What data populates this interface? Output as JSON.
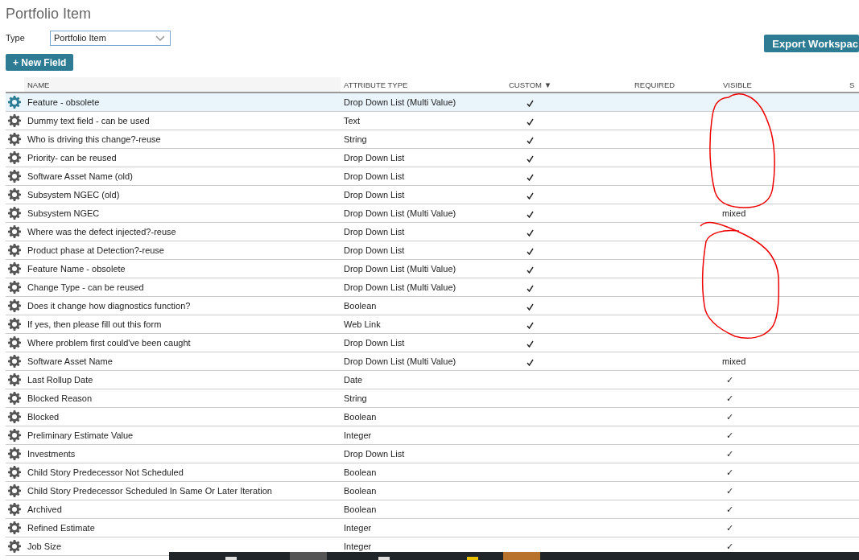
{
  "page": {
    "title": "Portfolio Item"
  },
  "type_field": {
    "label": "Type",
    "value": "Portfolio Item"
  },
  "buttons": {
    "new_field": "+ New Field",
    "export": "Export Workspac"
  },
  "table": {
    "columns": [
      {
        "label": "NAME",
        "kind": "text"
      },
      {
        "label": "ATTRIBUTE TYPE",
        "kind": "text"
      },
      {
        "label": "CUSTOM",
        "kind": "check",
        "sorted": true,
        "sort_icon": "▼"
      },
      {
        "label": "REQUIRED",
        "kind": "text"
      },
      {
        "label": "VISIBLE",
        "kind": "text"
      },
      {
        "label": "S",
        "kind": "text"
      }
    ],
    "rows": [
      {
        "name": "Feature - obsolete",
        "type": "Drop Down List (Multi Value)",
        "custom": true,
        "visible": "",
        "selected": true
      },
      {
        "name": "Dummy text field - can be used",
        "type": "Text",
        "custom": true,
        "visible": "",
        "selected": false
      },
      {
        "name": "Who is driving this change?-reuse",
        "type": "String",
        "custom": true,
        "visible": "",
        "selected": false
      },
      {
        "name": "Priority- can be reused",
        "type": "Drop Down List",
        "custom": true,
        "visible": "",
        "selected": false
      },
      {
        "name": "Software Asset Name (old)",
        "type": "Drop Down List",
        "custom": true,
        "visible": "",
        "selected": false
      },
      {
        "name": "Subsystem NGEC (old)",
        "type": "Drop Down List",
        "custom": true,
        "visible": "",
        "selected": false
      },
      {
        "name": "Subsystem NGEC",
        "type": "Drop Down List (Multi Value)",
        "custom": true,
        "visible": "mixed",
        "selected": false
      },
      {
        "name": "Where was the defect injected?-reuse",
        "type": "Drop Down List",
        "custom": true,
        "visible": "",
        "selected": false
      },
      {
        "name": "Product phase at Detection?-reuse",
        "type": "Drop Down List",
        "custom": true,
        "visible": "",
        "selected": false
      },
      {
        "name": "Feature Name - obsolete",
        "type": "Drop Down List (Multi Value)",
        "custom": true,
        "visible": "",
        "selected": false
      },
      {
        "name": "Change Type - can be reused",
        "type": "Drop Down List (Multi Value)",
        "custom": true,
        "visible": "",
        "selected": false
      },
      {
        "name": "Does it change how diagnostics function?",
        "type": "Boolean",
        "custom": true,
        "visible": "",
        "selected": false
      },
      {
        "name": "If yes, then please fill out this form",
        "type": "Web Link",
        "custom": true,
        "visible": "",
        "selected": false
      },
      {
        "name": "Where problem first could've been caught",
        "type": "Drop Down List",
        "custom": true,
        "visible": "",
        "selected": false
      },
      {
        "name": "Software Asset Name",
        "type": "Drop Down List (Multi Value)",
        "custom": true,
        "visible": "mixed",
        "selected": false
      },
      {
        "name": "Last Rollup Date",
        "type": "Date",
        "custom": false,
        "visible": "✓",
        "selected": false
      },
      {
        "name": "Blocked Reason",
        "type": "String",
        "custom": false,
        "visible": "✓",
        "selected": false
      },
      {
        "name": "Blocked",
        "type": "Boolean",
        "custom": false,
        "visible": "✓",
        "selected": false
      },
      {
        "name": "Preliminary Estimate Value",
        "type": "Integer",
        "custom": false,
        "visible": "✓",
        "selected": false
      },
      {
        "name": "Investments",
        "type": "Drop Down List",
        "custom": false,
        "visible": "✓",
        "selected": false
      },
      {
        "name": "Child Story Predecessor Not Scheduled",
        "type": "Boolean",
        "custom": false,
        "visible": "✓",
        "selected": false
      },
      {
        "name": "Child Story Predecessor Scheduled In Same Or Later Iteration",
        "type": "Boolean",
        "custom": false,
        "visible": "✓",
        "selected": false
      },
      {
        "name": "Archived",
        "type": "Boolean",
        "custom": false,
        "visible": "✓",
        "selected": false
      },
      {
        "name": "Refined Estimate",
        "type": "Integer",
        "custom": false,
        "visible": "✓",
        "selected": false
      },
      {
        "name": "Job Size",
        "type": "Integer",
        "custom": false,
        "visible": "✓",
        "selected": false
      }
    ]
  }
}
